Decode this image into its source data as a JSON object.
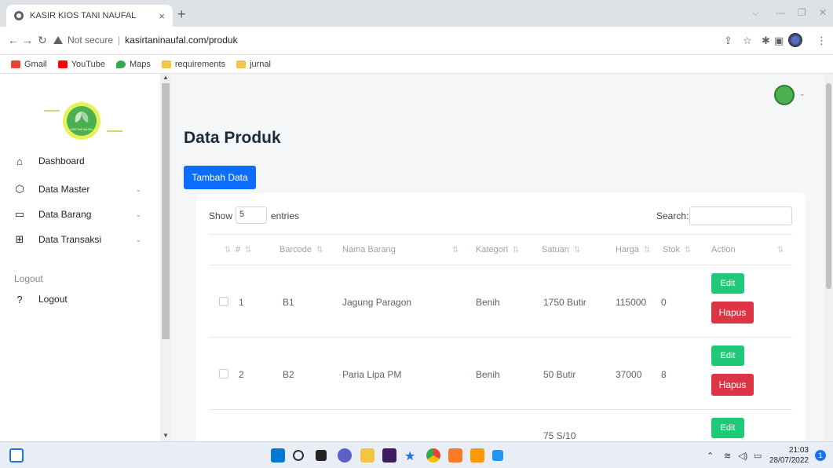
{
  "browser": {
    "tab_title": "KASIR KIOS TANI NAUFAL",
    "tab_close": "×",
    "new_tab": "+",
    "not_secure": "Not secure",
    "separator": "|",
    "url": "kasirtaninaufal.com/produk",
    "bookmarks": [
      {
        "label": "Gmail",
        "icon": "gmail-icon",
        "color": "#ea4335"
      },
      {
        "label": "YouTube",
        "icon": "youtube-icon",
        "color": "#ff0000"
      },
      {
        "label": "Maps",
        "icon": "maps-icon",
        "color": "#34a853"
      },
      {
        "label": "requirements",
        "icon": "folder-icon",
        "color": "#f4c542"
      },
      {
        "label": "jurnal",
        "icon": "folder-icon",
        "color": "#f4c542"
      }
    ]
  },
  "sidebar": {
    "logo_text": "KIOS TANI NAUFAL",
    "items": [
      {
        "label": "Dashboard",
        "icon": "home-icon"
      },
      {
        "label": "Data Master",
        "icon": "cube-icon",
        "has_chevron": true
      },
      {
        "label": "Data Barang",
        "icon": "card-icon",
        "has_chevron": true
      },
      {
        "label": "Data Transaksi",
        "icon": "grid-icon",
        "has_chevron": true
      }
    ],
    "section_heading": "Logout",
    "logout_label": "Logout",
    "logout_icon": "help-circle-icon"
  },
  "main": {
    "page_title": "Data Produk",
    "add_button": "Tambah Data",
    "show_label": "Show",
    "entries_value": "5",
    "entries_label": "entries",
    "search_label": "Search:",
    "columns": [
      "#",
      "Barcode",
      "Nama Barang",
      "Kategori",
      "Satuan",
      "Harga",
      "Stok",
      "Action"
    ],
    "rows": [
      {
        "no": "1",
        "barcode": "B1",
        "nama": "Jagung Paragon",
        "kategori": "Benih",
        "satuan": "1750 Butir",
        "harga": "115000",
        "stok": "0"
      },
      {
        "no": "2",
        "barcode": "B2",
        "nama": "Paria Lipa PM",
        "kategori": "Benih",
        "satuan": "50 Butir",
        "harga": "37000",
        "stok": "8"
      },
      {
        "no": "",
        "barcode": "",
        "nama": "",
        "kategori": "",
        "satuan": "75 S/10",
        "harga": "",
        "stok": ""
      }
    ],
    "edit_label": "Edit",
    "delete_label": "Hapus"
  },
  "taskbar": {
    "time": "21:03",
    "date": "28/07/2022",
    "notification_count": "1"
  },
  "colors": {
    "primary": "#0d6efd",
    "edit": "#20c978",
    "delete": "#dc3545",
    "logo_green": "#4caf50"
  }
}
